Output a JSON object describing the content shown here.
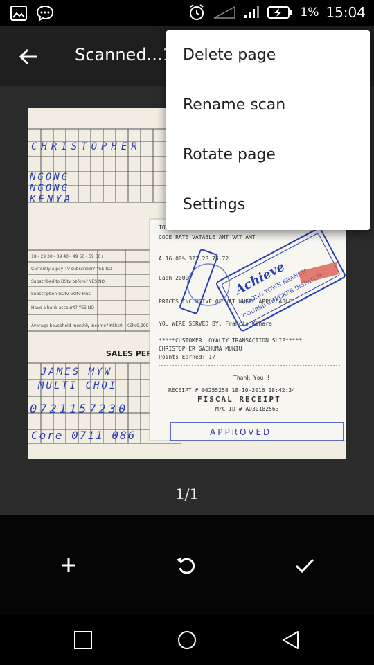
{
  "status_bar": {
    "battery_percent": "1%",
    "time": "15:04"
  },
  "toolbar": {
    "title": "Scanned...1"
  },
  "menu": {
    "items": [
      "Delete page",
      "Rename scan",
      "Rotate page",
      "Settings"
    ]
  },
  "document": {
    "receipt_lines": [
      "TOTAL ITEMS: 1",
      "CODE  RATE        VATABLE AMT     VAT AMT",
      "A  16.00%          323.28         75.72",
      "Cash              2000",
      "PRICES INCLUSIVE OF VAT WHERE APPLICABLE",
      "YOU WERE SERVED BY: Francis Kinara",
      "*****CUSTOMER LOYALTY TRANSACTION SLIP*****",
      "CHRISTOPHER GACHUMA MUNIU",
      "Points Earned: 17",
      "Thank You !",
      "RECEIPT # 00255258    18-10-2016  18:42:34",
      "FISCAL RECEIPT",
      "M/C ID # AD30182563"
    ],
    "stamp_lines": [
      "Achieve",
      "NGONG TOWN BRANCH",
      "COURSE CHECKER DISPATCH"
    ],
    "form_title": "SALES PER",
    "handwriting": [
      "CHRISTOPHER",
      "NGONG",
      "NGONG",
      "KENYA",
      "JAMES MYW",
      "MULTI CHOI",
      "0721157230",
      "Core 0711 086"
    ],
    "approved": "APPROVED"
  },
  "pager": {
    "text": "1/1"
  },
  "colors": {
    "menu_bg": "#ffffff",
    "menu_text": "#212121",
    "toolbar_bg": "#1f1f1f",
    "content_bg": "#2b2b2b",
    "ink_blue": "#2a3fb0"
  }
}
